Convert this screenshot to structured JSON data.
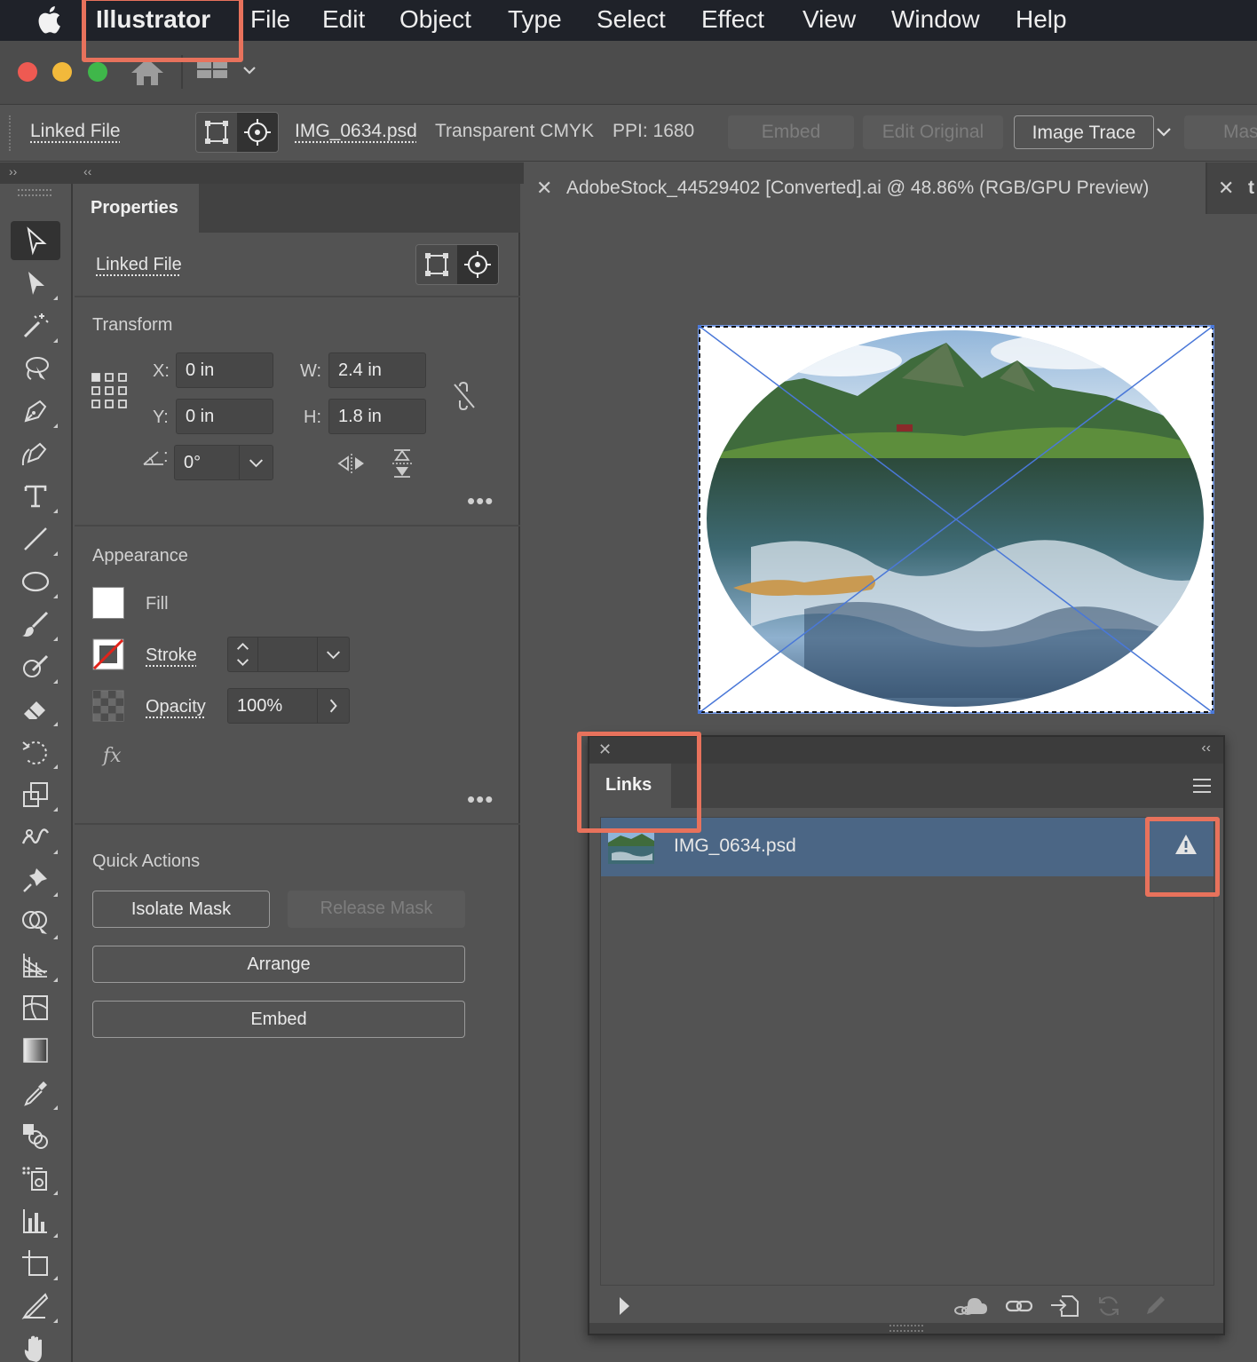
{
  "menubar": {
    "app_name": "Illustrator",
    "items": [
      "File",
      "Edit",
      "Object",
      "Type",
      "Select",
      "Effect",
      "View",
      "Window",
      "Help"
    ]
  },
  "control_bar": {
    "object_type": "Linked File",
    "file_name": "IMG_0634.psd",
    "color_mode": "Transparent CMYK",
    "ppi": "PPI: 1680",
    "embed_label": "Embed",
    "edit_original_label": "Edit Original",
    "image_trace_label": "Image Trace",
    "mask_label": "Mas"
  },
  "properties": {
    "tab_label": "Properties",
    "object_type": "Linked File",
    "transform": {
      "title": "Transform",
      "x_label": "X:",
      "x_value": "0 in",
      "y_label": "Y:",
      "y_value": "0 in",
      "w_label": "W:",
      "w_value": "2.4 in",
      "h_label": "H:",
      "h_value": "1.8 in",
      "angle_label": ":",
      "angle_value": "0°"
    },
    "appearance": {
      "title": "Appearance",
      "fill_label": "Fill",
      "stroke_label": "Stroke",
      "opacity_label": "Opacity",
      "opacity_value": "100%",
      "fx_label": "fx"
    },
    "quick_actions": {
      "title": "Quick Actions",
      "isolate_mask": "Isolate Mask",
      "release_mask": "Release Mask",
      "arrange": "Arrange",
      "embed": "Embed"
    }
  },
  "document": {
    "tab_title": "AdobeStock_44529402 [Converted].ai @ 48.86% (RGB/GPU Preview)",
    "next_tab_partial": "t"
  },
  "links_panel": {
    "tab_label": "Links",
    "items": [
      {
        "name": "IMG_0634.psd",
        "status_icon": "warning-triangle-icon"
      }
    ]
  },
  "colors": {
    "highlight": "#e8725c",
    "selection_blue": "#4a78d8",
    "link_row_selected": "#4b6685"
  }
}
